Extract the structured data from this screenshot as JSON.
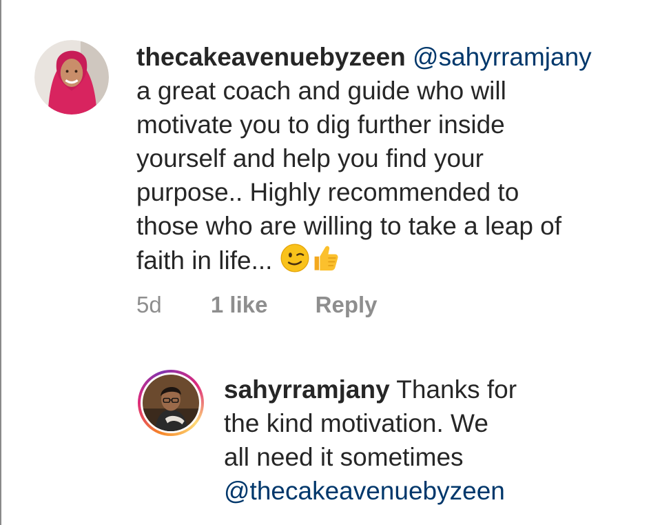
{
  "comment": {
    "username": "thecakeavenuebyzeen",
    "mention": "@sahyrramjany",
    "text_lines": [
      "a great coach and guide who will",
      "motivate you to dig further inside",
      "yourself and help you find your",
      "purpose.. Highly recommended to",
      "those who are willing to take a leap of",
      "faith in life..."
    ],
    "emojis": [
      "winking-face",
      "thumbs-up"
    ],
    "meta": {
      "time": "5d",
      "likes": "1 like",
      "reply_label": "Reply"
    }
  },
  "reply": {
    "username": "sahyrramjany",
    "text_lines": [
      "Thanks for",
      "the kind motivation. We",
      "all need it sometimes"
    ],
    "mention": "@thecakeavenuebyzeen"
  },
  "colors": {
    "mention": "#00376b",
    "meta": "#8e8e8e",
    "story_ring": [
      "#f58529",
      "#dd2a7b",
      "#8134af"
    ]
  }
}
